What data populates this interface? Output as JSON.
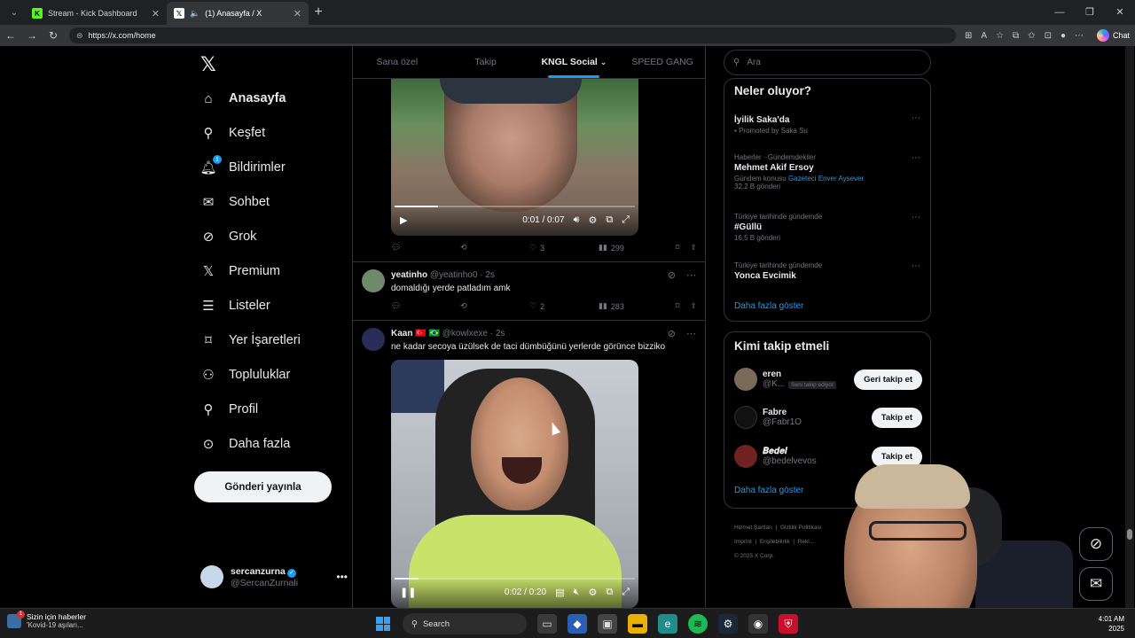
{
  "browser": {
    "tabs": [
      {
        "title": "Stream - Kick Dashboard",
        "favicon": "K",
        "favicon_color": "#53fc18"
      },
      {
        "title": "(1) Anasayfa / X",
        "favicon": "𝕏",
        "favicon_color": "#000000"
      }
    ],
    "url": "https://x.com/home",
    "chat_label": "Chat"
  },
  "nav": {
    "items": [
      {
        "label": "Anasayfa",
        "icon": "home-icon",
        "active": true
      },
      {
        "label": "Keşfet",
        "icon": "search-icon"
      },
      {
        "label": "Bildirimler",
        "icon": "bell-icon",
        "badge": "1"
      },
      {
        "label": "Sohbet",
        "icon": "envelope-icon"
      },
      {
        "label": "Grok",
        "icon": "grok-icon"
      },
      {
        "label": "Premium",
        "icon": "x-logo-icon"
      },
      {
        "label": "Listeler",
        "icon": "list-icon"
      },
      {
        "label": "Yer İşaretleri",
        "icon": "bookmark-icon"
      },
      {
        "label": "Topluluklar",
        "icon": "communities-icon"
      },
      {
        "label": "Profil",
        "icon": "person-icon"
      },
      {
        "label": "Daha fazla",
        "icon": "more-circle-icon"
      }
    ],
    "post_button": "Gönderi yayınla",
    "profile": {
      "name": "sercanzurna",
      "handle": "@SercanZurnali"
    }
  },
  "feed": {
    "tabs": [
      "Sana özel",
      "Takip",
      "KNGL Social",
      "SPEED GANG"
    ],
    "active_tab": "KNGL Social",
    "video1": {
      "time": "0:01 / 0:07",
      "progress": 0.18
    },
    "post0_stats": {
      "replies": "",
      "reposts": "",
      "likes": "3",
      "views": "299"
    },
    "post1": {
      "name": "yeatinho",
      "handle": "@yeatinho0",
      "time": "· 2s",
      "text": "domaldığı yerde patladım amk",
      "stats": {
        "likes": "2",
        "views": "283"
      }
    },
    "post2": {
      "name": "Kaan",
      "flags": "🇹🇷 🇧🇷",
      "handle": "@kowlxexe",
      "time": "· 2s",
      "text": "ne kadar secoya üzülsek de taci dümbüğünü yerlerde görünce bizziko",
      "video_time": "0:02 / 0:20",
      "progress": 0.1
    }
  },
  "sidebar": {
    "search_placeholder": "Ara",
    "trends_title": "Neler oluyor?",
    "trends": [
      {
        "meta": "",
        "topic": "İyilik Saka'da",
        "sub": "Promoted by Saka Su",
        "link": ""
      },
      {
        "meta": "Haberler · Gündemdekiler",
        "topic": "Mehmet Akif Ersoy",
        "sub": "Gündem konusu ",
        "link": "Gazeteci Enver Aysever",
        "sub2": "32,2 B gönderi"
      },
      {
        "meta": "Türkiye tarihinde gündemde",
        "topic": "#Güllü",
        "sub": "16,5 B gönderi",
        "link": ""
      },
      {
        "meta": "Türkiye tarihinde gündemde",
        "topic": "Yonca Evcimik",
        "sub": "",
        "link": ""
      }
    ],
    "show_more": "Daha fazla göster",
    "who_title": "Kimi takip etmeli",
    "who": [
      {
        "name": "eren",
        "handle": "@K...",
        "note": "Seni takip ediyor",
        "button": "Geri takip et"
      },
      {
        "name": "Fabre",
        "handle": "@Fabr1O",
        "note": "",
        "button": "Takip et"
      },
      {
        "name": "𝑩𝒆𝒅𝒆𝒍",
        "handle": "@bedelvevos",
        "note": "",
        "button": "Takip et"
      }
    ],
    "who_show_more": "Daha fazla göster",
    "footer": [
      "Hizmet Şartları",
      "|",
      "Gizlilik Politikası",
      "Imprint",
      "|",
      "Erişilebilirlik",
      "|",
      "Rekl...",
      "© 2025 X Corp."
    ]
  },
  "taskbar": {
    "news_title": "Sizin için haberler",
    "news_sub": "'Kovid-19 aşıları...",
    "news_badge": "1",
    "search": "Search",
    "time": "4:01 AM",
    "date": "2025"
  }
}
